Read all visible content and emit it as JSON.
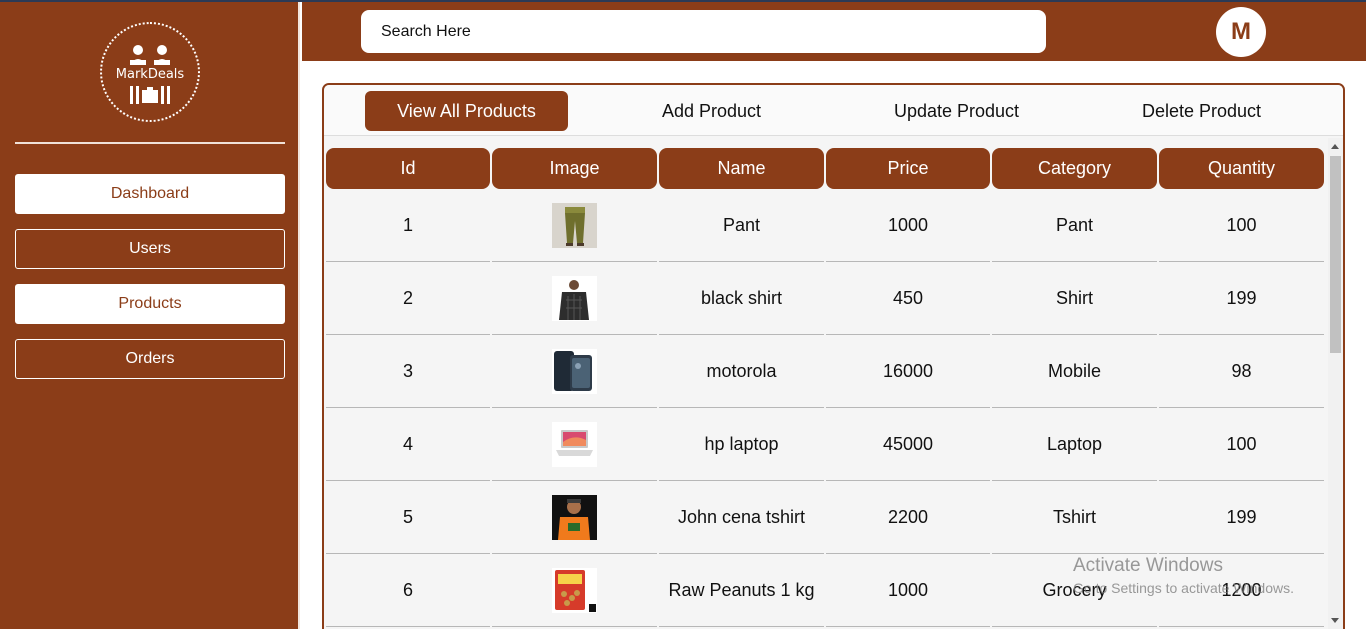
{
  "brand": {
    "logo_text": "MarkDeals"
  },
  "sidebar": {
    "items": [
      {
        "label": "Dashboard"
      },
      {
        "label": "Users"
      },
      {
        "label": "Products"
      },
      {
        "label": "Orders"
      }
    ]
  },
  "header": {
    "search_placeholder": "Search Here",
    "avatar_letter": "M"
  },
  "tabs": [
    {
      "label": "View All Products",
      "active": true
    },
    {
      "label": "Add Product"
    },
    {
      "label": "Update Product"
    },
    {
      "label": "Delete Product"
    }
  ],
  "table": {
    "columns": [
      "Id",
      "Image",
      "Name",
      "Price",
      "Category",
      "Quantity"
    ],
    "rows": [
      {
        "id": "1",
        "image": "pant-image",
        "name": "Pant",
        "price": "1000",
        "category": "Pant",
        "quantity": "100"
      },
      {
        "id": "2",
        "image": "black-shirt-image",
        "name": "black shirt",
        "price": "450",
        "category": "Shirt",
        "quantity": "199"
      },
      {
        "id": "3",
        "image": "motorola-image",
        "name": "motorola",
        "price": "16000",
        "category": "Mobile",
        "quantity": "98"
      },
      {
        "id": "4",
        "image": "laptop-image",
        "name": "hp laptop",
        "price": "45000",
        "category": "Laptop",
        "quantity": "100"
      },
      {
        "id": "5",
        "image": "tshirt-image",
        "name": "John cena tshirt",
        "price": "2200",
        "category": "Tshirt",
        "quantity": "199"
      },
      {
        "id": "6",
        "image": "peanuts-image",
        "name": "Raw Peanuts 1 kg",
        "price": "1000",
        "category": "Grocery",
        "quantity": "1200"
      }
    ]
  },
  "watermark": {
    "title": "Activate Windows",
    "subtitle": "Go to Settings to activate Windows."
  },
  "colors": {
    "brand": "#8b3d18",
    "panel": "#f5f5f5"
  }
}
